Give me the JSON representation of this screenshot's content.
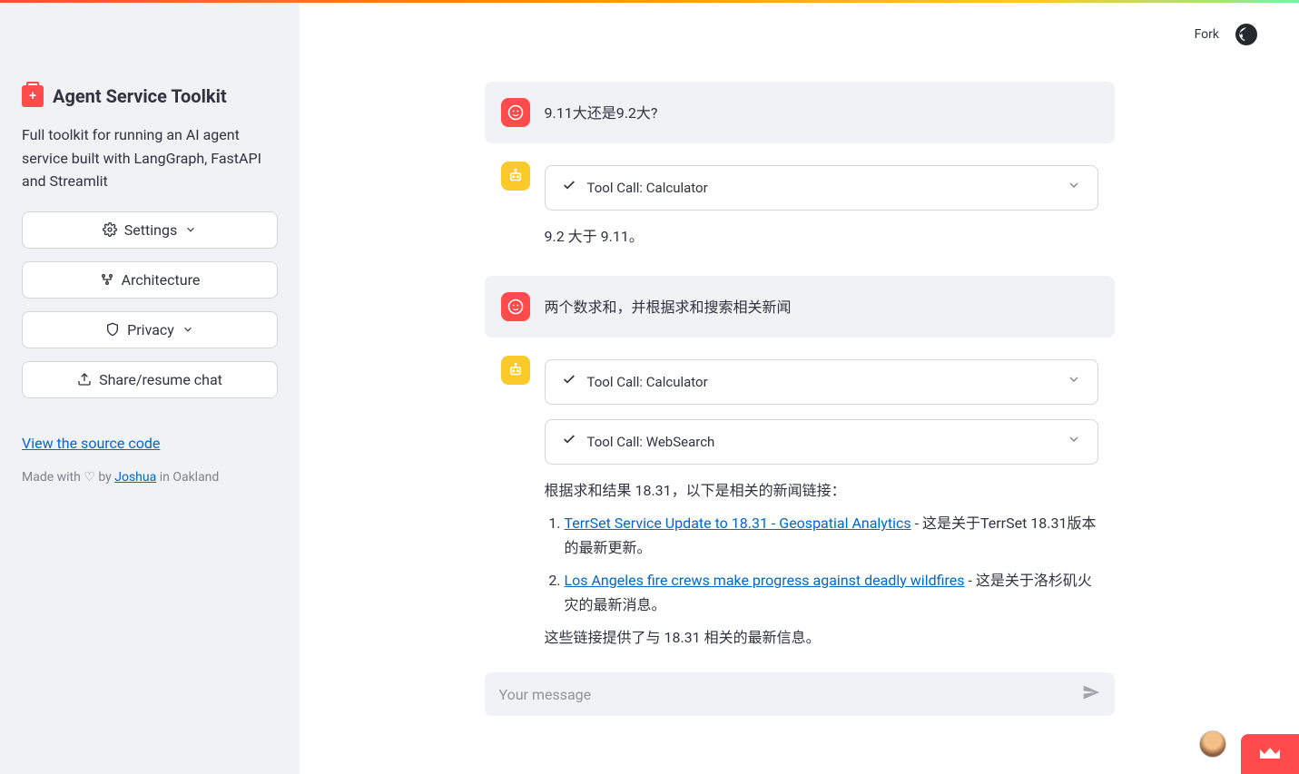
{
  "sidebar": {
    "title": "Agent Service Toolkit",
    "description": "Full toolkit for running an AI agent service built with LangGraph, FastAPI and Streamlit",
    "buttons": {
      "settings": "Settings",
      "architecture": "Architecture",
      "privacy": "Privacy",
      "share": "Share/resume chat"
    },
    "source_link": "View the source code",
    "made_prefix": "Made with ",
    "made_by": " by ",
    "author": "Joshua",
    "made_suffix": " in Oakland"
  },
  "header": {
    "fork": "Fork"
  },
  "chat": {
    "user1": "9.11大还是9.2大?",
    "tool_calc": "Tool Call: Calculator",
    "ai1": "9.2 大于 9.11。",
    "user2": "两个数求和，并根据求和搜索相关新闻",
    "tool_web": "Tool Call: WebSearch",
    "ai2_intro": "根据求和结果 18.31，以下是相关的新闻链接：",
    "ai2_item1_link": "TerrSet Service Update to 18.31 - Geospatial Analytics",
    "ai2_item1_tail": " - 这是关于TerrSet 18.31版本的最新更新。",
    "ai2_item2_link": "Los Angeles fire crews make progress against deadly wildfires",
    "ai2_item2_tail": " - 这是关于洛杉矶火灾的最新消息。",
    "ai2_outro": "这些链接提供了与 18.31 相关的最新信息。"
  },
  "input": {
    "placeholder": "Your message"
  }
}
